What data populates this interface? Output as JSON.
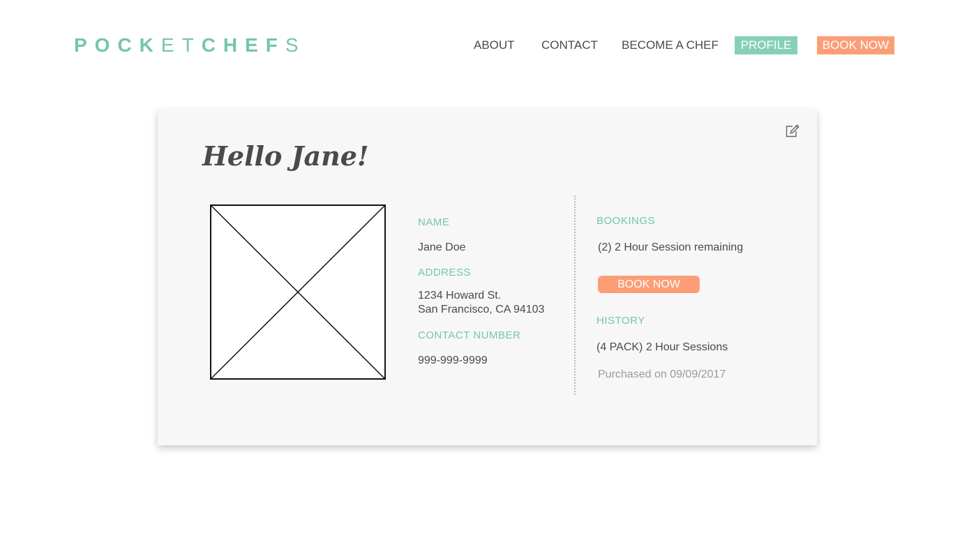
{
  "brand": {
    "logo_bold_1": "POCK",
    "logo_thin_1": "ET",
    "logo_bold_2": "CHEF",
    "logo_thin_2": "S",
    "color": "#74c6aa"
  },
  "nav": {
    "about": "ABOUT",
    "contact": "CONTACT",
    "become_chef": "BECOME A CHEF",
    "profile": "PROFILE",
    "book_now": "BOOK NOW"
  },
  "profile": {
    "greeting": "Hello Jane!",
    "edit_icon": "edit-icon",
    "avatar": "image-placeholder",
    "name_label": "NAME",
    "name": "Jane Doe",
    "address_label": "ADDRESS",
    "address_line1": "1234 Howard St.",
    "address_line2": "San Francisco, CA 94103",
    "contact_label": "CONTACT NUMBER",
    "contact": "999-999-9999"
  },
  "bookings": {
    "label": "BOOKINGS",
    "remaining": "(2) 2 Hour Session remaining",
    "book_button": "BOOK NOW"
  },
  "history": {
    "label": "HISTORY",
    "item": "(4 PACK) 2 Hour Sessions",
    "purchased": "Purchased on 09/09/2017"
  },
  "colors": {
    "accent_green": "#74c6aa",
    "profile_tab": "#86d1b6",
    "accent_orange": "#fb9e78",
    "card_background": "#f7f7f7",
    "text": "#4a4a4a",
    "muted_text": "#9a9a9a"
  }
}
